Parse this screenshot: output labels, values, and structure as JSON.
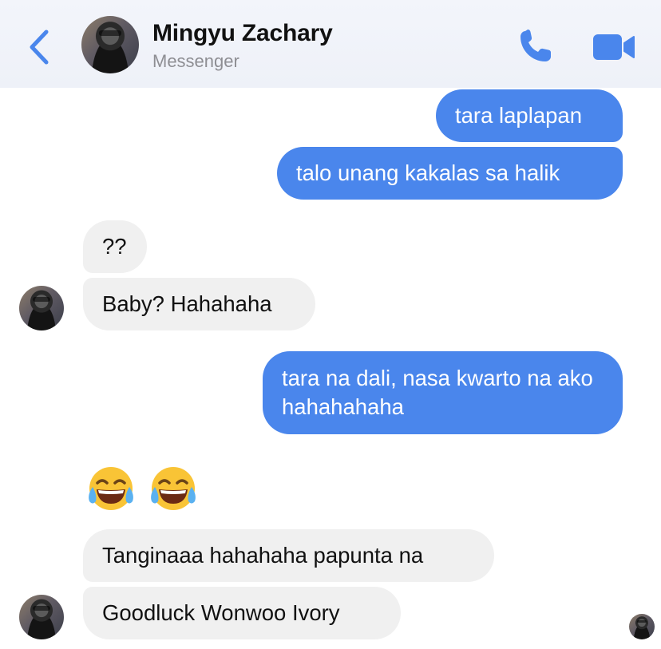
{
  "header": {
    "contact_name": "Mingyu Zachary",
    "subtitle": "Messenger",
    "back_icon": "chevron-left-icon",
    "call_icon": "phone-icon",
    "video_icon": "video-camera-icon",
    "accent_color": "#4a86ec"
  },
  "messages": [
    {
      "id": "m1",
      "direction": "outgoing",
      "text": "tara laplapan"
    },
    {
      "id": "m2",
      "direction": "outgoing",
      "text": "talo unang kakalas sa halik"
    },
    {
      "id": "m3",
      "direction": "incoming",
      "text": "??"
    },
    {
      "id": "m4",
      "direction": "incoming",
      "text": "Baby? Hahahaha"
    },
    {
      "id": "m5",
      "direction": "outgoing",
      "text": "tara na dali, nasa kwarto na ako hahahahaha"
    },
    {
      "id": "m6",
      "direction": "incoming",
      "emoji": [
        "face-with-tears-of-joy",
        "face-with-tears-of-joy"
      ]
    },
    {
      "id": "m7",
      "direction": "incoming",
      "text": "Tanginaaa hahahaha papunta na"
    },
    {
      "id": "m8",
      "direction": "incoming",
      "text": "Goodluck Wonwoo Ivory"
    }
  ],
  "colors": {
    "outgoing_bubble": "#4a86ec",
    "incoming_bubble": "#f0f0f0"
  }
}
